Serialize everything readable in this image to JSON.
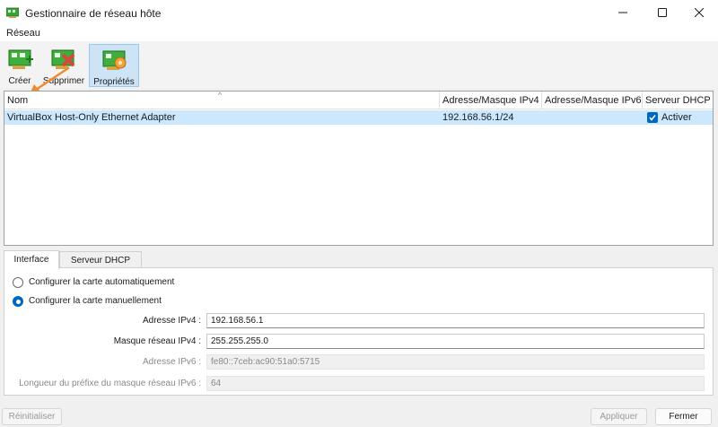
{
  "window": {
    "title": "Gestionnaire de réseau hôte"
  },
  "menu": {
    "items": [
      "Réseau"
    ]
  },
  "toolbar": {
    "create_label": "Créer",
    "delete_label": "Supprimer",
    "properties_label": "Propriétés"
  },
  "table": {
    "columns": [
      "Nom",
      "Adresse/Masque IPv4",
      "Adresse/Masque IPv6",
      "Serveur DHCP"
    ],
    "rows": [
      {
        "name": "VirtualBox Host-Only Ethernet Adapter",
        "ipv4": "192.168.56.1/24",
        "ipv6": "",
        "dhcp_checked": true,
        "dhcp_label": "Activer"
      }
    ]
  },
  "tabs": {
    "items": [
      "Interface",
      "Serveur DHCP"
    ],
    "active": "Interface"
  },
  "interface": {
    "auto_label": "Configurer la carte automatiquement",
    "manual_label": "Configurer la carte manuellement",
    "selected": "manual",
    "ipv4_label": "Adresse IPv4 :",
    "ipv4_value": "192.168.56.1",
    "mask_label": "Masque réseau IPv4 :",
    "mask_value": "255.255.255.0",
    "ipv6_label": "Adresse IPv6 :",
    "ipv6_value": "fe80::7ceb:ac90:51a0:5715",
    "prefix_label": "Longueur du préfixe du masque réseau IPv6 :",
    "prefix_value": "64"
  },
  "buttons": {
    "reset": "Réinitialiser",
    "apply": "Appliquer",
    "close": "Fermer"
  },
  "colors": {
    "accent": "#0067c0",
    "selection": "#cce8ff",
    "arrow": "#f08a2c"
  }
}
